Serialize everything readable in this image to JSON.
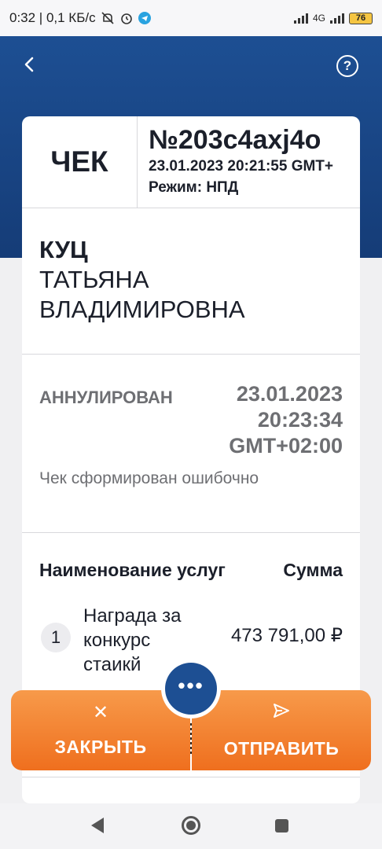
{
  "status_bar": {
    "left_text": "0:32 | 0,1 КБ/с",
    "right_net": "4G",
    "battery": "76",
    "icons": [
      "mute-icon",
      "alarm-icon",
      "telegram-icon",
      "signal-icon",
      "battery-icon"
    ]
  },
  "header": {
    "back_icon": "chevron-left-icon",
    "help_icon": "question-circle-icon",
    "help_glyph": "?",
    "bg_color": "#1d4f93"
  },
  "receipt": {
    "kind": "ЧЕК",
    "number": "№203c4axj4o",
    "datetime": "23.01.2023 20:21:55 GMT+",
    "mode": "Режим: НПД"
  },
  "person": {
    "last_name": "КУЦ",
    "first_line": "ТАТЬЯНА",
    "second_line": "ВЛАДИМИРОВНА"
  },
  "status": {
    "label": "АННУЛИРОВАН",
    "date": "23.01.2023",
    "time": "20:23:34",
    "tz": "GMT+02:00",
    "reason": "Чек сформирован ошибочно"
  },
  "services": {
    "header_name": "Наименование услуг",
    "header_sum": "Сумма",
    "items": [
      {
        "index": "1",
        "name": "Награда за конкурс стаикй",
        "sum": "473 791,00 ₽"
      }
    ]
  },
  "actions": {
    "close_label": "ЗАКРЫТЬ",
    "close_icon": "close-icon",
    "close_glyph": "✕",
    "send_label": "ОТПРАВИТЬ",
    "send_icon": "send-icon",
    "send_glyph": "➢",
    "more_glyph": "•••",
    "accent": "#ef7a2a"
  }
}
